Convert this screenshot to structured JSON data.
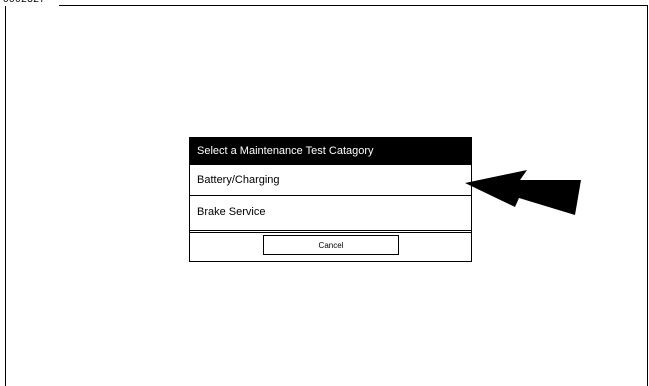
{
  "figure_id": "0002327",
  "dialog": {
    "title": "Select a Maintenance Test Catagory",
    "options": [
      {
        "label": "Battery/Charging"
      },
      {
        "label": "Brake Service"
      }
    ],
    "cancel_label": "Cancel"
  },
  "callout": {
    "icon": "callout-arrow-icon",
    "color": "#000000"
  }
}
